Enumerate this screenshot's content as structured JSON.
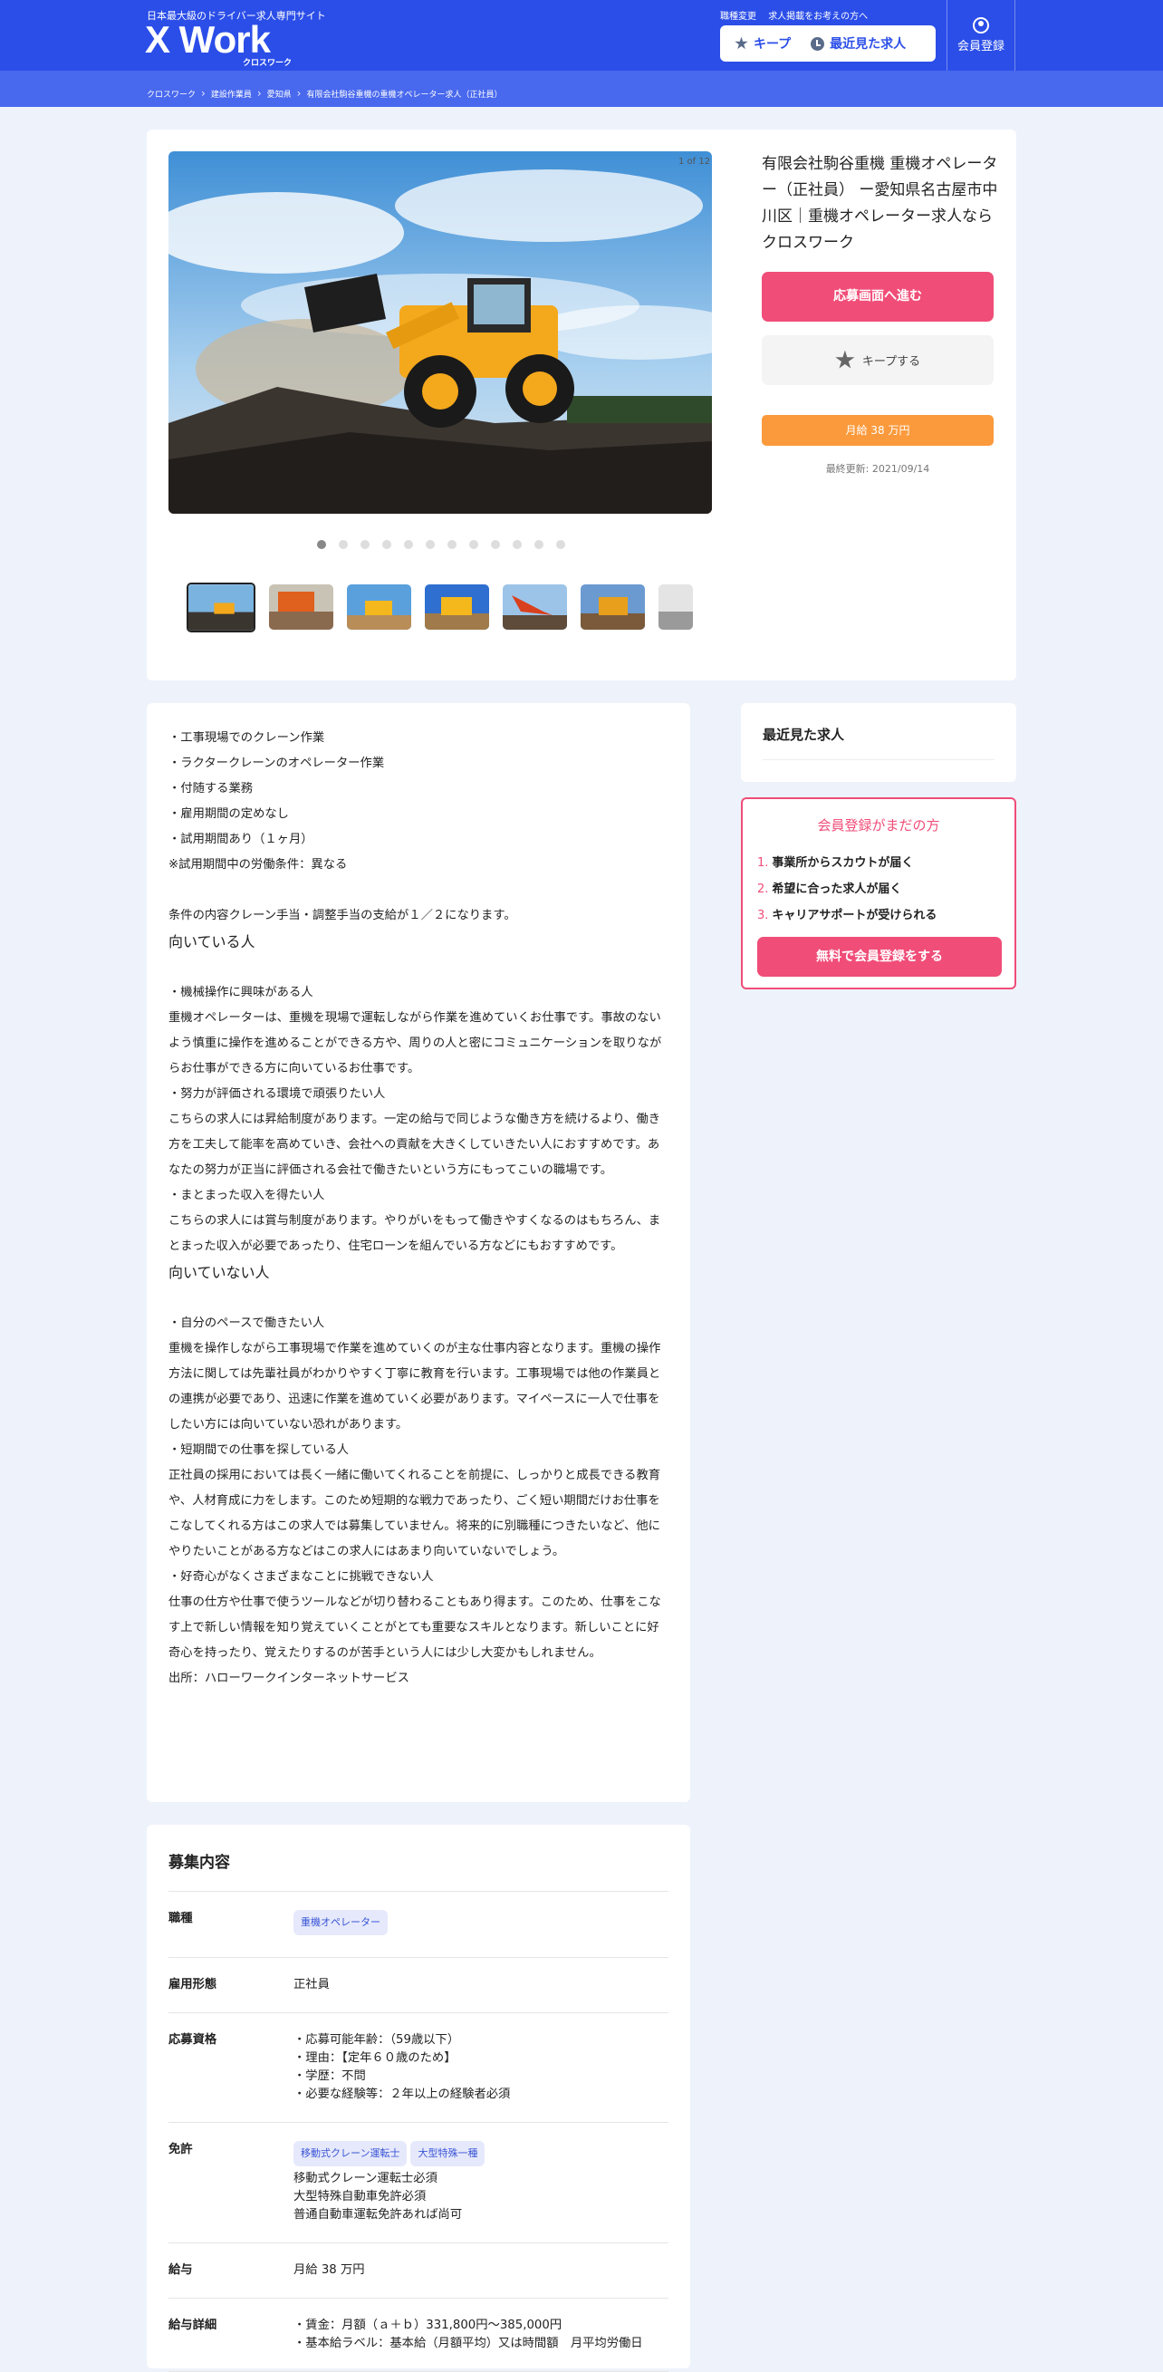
{
  "header": {
    "tagline": "日本最大級のドライバー求人専門サイト",
    "logo": "X Work",
    "logo_sub": "クロスワーク",
    "links": [
      "職種変更",
      "求人掲載をお考えの方へ"
    ],
    "keep_label": "キープ",
    "recent_label": "最近見た求人",
    "member_label": "会員登録"
  },
  "breadcrumb": [
    "クロスワーク",
    "建設作業員",
    "愛知県",
    "有限会社駒谷重機の重機オペレーター求人（正社員）"
  ],
  "gallery": {
    "counter": "1 of 12",
    "dot_count": 12,
    "active_dot": 0
  },
  "job": {
    "title": "有限会社駒谷重機 重機オペレーター（正社員） ー愛知県名古屋市中川区｜重機オペレーター求人ならクロスワーク",
    "apply_label": "応募画面へ進む",
    "keep_label": "キープする",
    "salary_badge": "月給 38 万円",
    "updated": "最終更新: 2021/09/14"
  },
  "description": {
    "lines": [
      "・工事現場でのクレーン作業",
      "・ラクタークレーンのオペレーター作業",
      "・付随する業務",
      "・雇用期間の定めなし",
      "・試用期間あり（１ヶ月）",
      "※試用期間中の労働条件：異なる",
      "",
      "条件の内容クレーン手当・調整手当の支給が１／２になります。"
    ],
    "heading_suited": "向いている人",
    "suited_lines": [
      "",
      "・機械操作に興味がある人",
      "重機オペレーターは、重機を現場で運転しながら作業を進めていくお仕事です。事故のないよう慎重に操作を進めることができる方や、周りの人と密にコミュニケーションを取りながらお仕事ができる方に向いているお仕事です。",
      "・努力が評価される環境で頑張りたい人",
      "こちらの求人には昇給制度があります。一定の給与で同じような働き方を続けるより、働き方を工夫して能率を高めていき、会社への貢献を大きくしていきたい人におすすめです。あなたの努力が正当に評価される会社で働きたいという方にもってこいの職場です。",
      "・まとまった収入を得たい人",
      "こちらの求人には賞与制度があります。やりがいをもって働きやすくなるのはもちろん、まとまった収入が必要であったり、住宅ローンを組んでいる方などにもおすすめです。"
    ],
    "heading_unsuited": "向いていない人",
    "unsuited_lines": [
      "",
      "・自分のペースで働きたい人",
      "重機を操作しながら工事現場で作業を進めていくのが主な仕事内容となります。重機の操作方法に関しては先輩社員がわかりやすく丁寧に教育を行います。工事現場では他の作業員との連携が必要であり、迅速に作業を進めていく必要があります。マイペースに一人で仕事をしたい方には向いていない恐れがあります。",
      "・短期間での仕事を探している人",
      "正社員の採用においては長く一緒に働いてくれることを前提に、しっかりと成長できる教育や、人材育成に力をします。このため短期的な戦力であったり、ごく短い期間だけお仕事をこなしてくれる方はこの求人では募集していません。将来的に別職種につきたいなど、他にやりたいことがある方などはこの求人にはあまり向いていないでしょう。",
      "・好奇心がなくさまざまなことに挑戦できない人",
      "仕事の仕方や仕事で使うツールなどが切り替わることもあり得ます。このため、仕事をこなす上で新しい情報を知り覚えていくことがとても重要なスキルとなります。新しいことに好奇心を持ったり、覚えたりするのが苦手という人には少し大変かもしれません。",
      "出所：ハローワークインターネットサービス"
    ]
  },
  "sidebar": {
    "recent_title": "最近見た求人",
    "register": {
      "title": "会員登録がまだの方",
      "benefits": [
        "事業所からスカウトが届く",
        "希望に合った求人が届く",
        "キャリアサポートが受けられる"
      ],
      "button": "無料で会員登録をする"
    }
  },
  "recruitment": {
    "title": "募集内容",
    "rows": [
      {
        "key": "職種",
        "tags": [
          "重機オペレーター"
        ],
        "lines": []
      },
      {
        "key": "雇用形態",
        "tags": [],
        "lines": [
          "正社員"
        ]
      },
      {
        "key": "応募資格",
        "tags": [],
        "lines": [
          "・応募可能年齢：（59歳以下）",
          "・理由：【定年６０歳のため】",
          "・学歴：不問",
          "・必要な経験等：２年以上の経験者必須"
        ]
      },
      {
        "key": "免許",
        "tags": [
          "移動式クレーン運転士",
          "大型特殊一種"
        ],
        "lines": [
          "移動式クレーン運転士必須",
          "大型特殊自動車免許必須",
          "普通自動車運転免許あれば尚可"
        ]
      },
      {
        "key": "給与",
        "tags": [],
        "lines": [
          "月給 38 万円"
        ]
      },
      {
        "key": "給与詳細",
        "tags": [],
        "lines": [
          "・賃金：月額（ａ＋ｂ）331,800円〜385,000円",
          "・基本給ラベル：基本給（月額平均）又は時間額　月平均労働日"
        ]
      }
    ]
  },
  "colors": {
    "header": "#2b4ee8",
    "accent_pink": "#f04d78",
    "salary_orange": "#fb9a3c"
  }
}
